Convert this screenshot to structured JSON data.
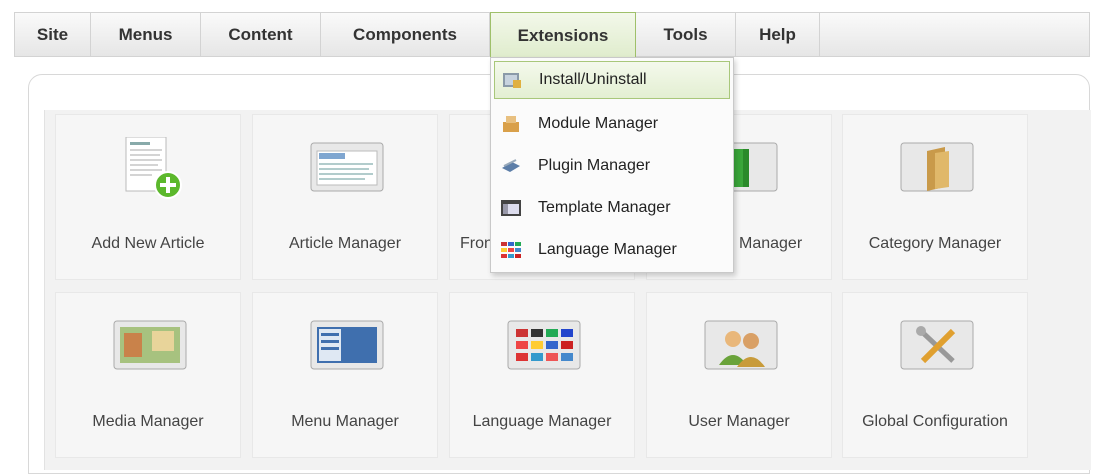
{
  "menubar": {
    "items": [
      {
        "label": "Site"
      },
      {
        "label": "Menus"
      },
      {
        "label": "Content"
      },
      {
        "label": "Components"
      },
      {
        "label": "Extensions"
      },
      {
        "label": "Tools"
      },
      {
        "label": "Help"
      }
    ],
    "active": "Extensions"
  },
  "extensions_menu": {
    "items": [
      {
        "label": "Install/Uninstall",
        "icon": "install-icon",
        "highlighted": true
      },
      {
        "label": "Module Manager",
        "icon": "module-icon"
      },
      {
        "label": "Plugin Manager",
        "icon": "plugin-icon"
      },
      {
        "label": "Template Manager",
        "icon": "template-icon"
      },
      {
        "label": "Language Manager",
        "icon": "language-flags-icon"
      }
    ]
  },
  "control_panel": {
    "tiles": [
      {
        "label": "Add New Article",
        "icon": "add-article-icon"
      },
      {
        "label": "Article Manager",
        "icon": "article-manager-icon"
      },
      {
        "label": "Front",
        "icon": "frontpage-icon"
      },
      {
        "label": "Manager",
        "icon": "section-manager-icon"
      },
      {
        "label": "Category Manager",
        "icon": "category-folder-icon"
      },
      {
        "label": "Media Manager",
        "icon": "media-icon"
      },
      {
        "label": "Menu Manager",
        "icon": "menu-icon"
      },
      {
        "label": "Language Manager",
        "icon": "language-flags-icon"
      },
      {
        "label": "User Manager",
        "icon": "users-icon"
      },
      {
        "label": "Global Configuration",
        "icon": "tools-icon"
      }
    ]
  },
  "colors": {
    "active_border": "#9fc06a",
    "highlight_bg": "#e3efd2",
    "plus_green": "#5cb82c"
  }
}
